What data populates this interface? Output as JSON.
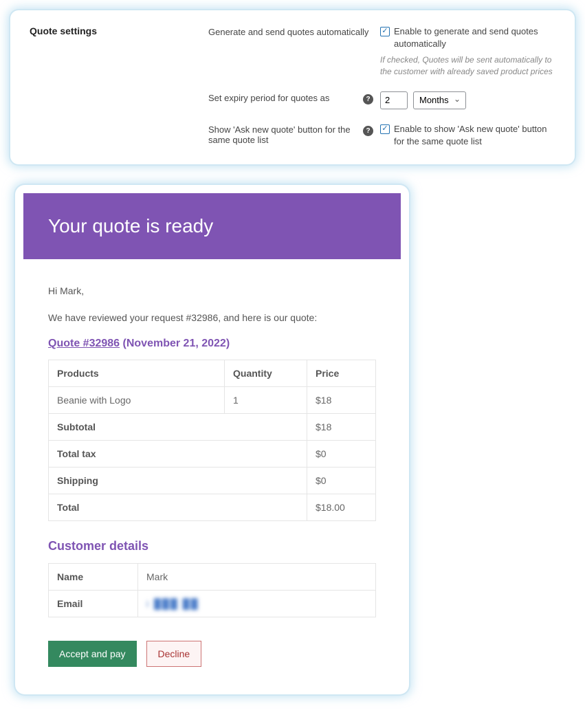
{
  "settings": {
    "section_title": "Quote settings",
    "rows": {
      "auto": {
        "label": "Generate and send quotes automatically",
        "checkbox_label": "Enable to generate and send quotes automatically",
        "hint": "If checked, Quotes will be sent automatically to the customer with already saved product prices"
      },
      "expiry": {
        "label": "Set expiry period for quotes as",
        "value": "2",
        "unit_selected": "Months"
      },
      "asknew": {
        "label": "Show 'Ask new quote' button for the same quote list",
        "checkbox_label": "Enable to show 'Ask new quote' button for the same quote list"
      }
    }
  },
  "email": {
    "header": "Your quote is ready",
    "greeting": "Hi Mark,",
    "intro": "We have reviewed your request #32986, and here is our quote:",
    "quote_link_text": "Quote #32986",
    "quote_date": "(November 21, 2022)",
    "table": {
      "head": {
        "products": "Products",
        "quantity": "Quantity",
        "price": "Price"
      },
      "item": {
        "name": "Beanie with Logo",
        "qty": "1",
        "price": "$18"
      },
      "subtotal": {
        "label": "Subtotal",
        "value": "$18"
      },
      "tax": {
        "label": "Total tax",
        "value": "$0"
      },
      "shipping": {
        "label": "Shipping",
        "value": "$0"
      },
      "total": {
        "label": "Total",
        "value": "$18.00"
      }
    },
    "customer": {
      "heading": "Customer details",
      "name_label": "Name",
      "name_value": "Mark",
      "email_label": "Email",
      "email_value": "i ███ ██"
    },
    "buttons": {
      "accept": "Accept and pay",
      "decline": "Decline"
    }
  }
}
